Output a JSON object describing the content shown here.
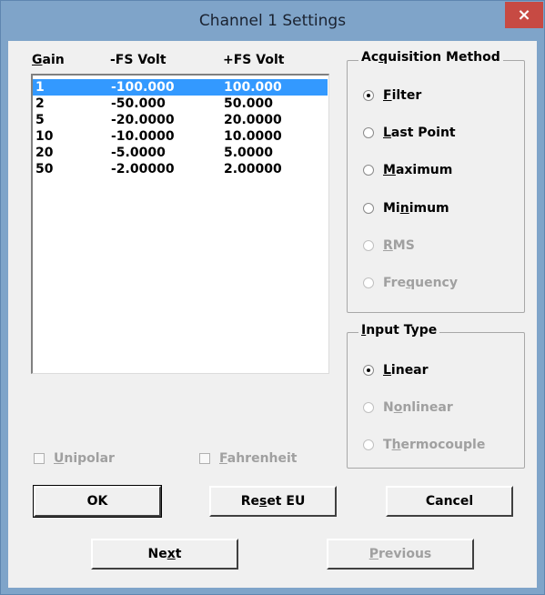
{
  "window": {
    "title": "Channel 1 Settings",
    "close_glyph": "×"
  },
  "gain_table": {
    "headers": {
      "gain": "Gain",
      "neg_fs": "-FS Volt",
      "pos_fs": "+FS Volt"
    },
    "rows": [
      {
        "gain": "1",
        "neg": "-100.000",
        "pos": "100.000",
        "selected": true
      },
      {
        "gain": "2",
        "neg": "-50.000",
        "pos": "50.000"
      },
      {
        "gain": "5",
        "neg": "-20.0000",
        "pos": "20.0000"
      },
      {
        "gain": "10",
        "neg": "-10.0000",
        "pos": "10.0000"
      },
      {
        "gain": "20",
        "neg": "-5.0000",
        "pos": "5.0000"
      },
      {
        "gain": "50",
        "neg": "-2.00000",
        "pos": "2.00000"
      }
    ]
  },
  "acquisition": {
    "title": "Acquisition Method",
    "options": [
      {
        "label": "Filter",
        "checked": true,
        "enabled": true
      },
      {
        "label": "Last Point",
        "checked": false,
        "enabled": true
      },
      {
        "label": "Maximum",
        "checked": false,
        "enabled": true
      },
      {
        "label": "Minimum",
        "checked": false,
        "enabled": true
      },
      {
        "label": "RMS",
        "checked": false,
        "enabled": false
      },
      {
        "label": "Frequency",
        "checked": false,
        "enabled": false
      }
    ]
  },
  "input_type": {
    "title": "Input Type",
    "options": [
      {
        "label": "Linear",
        "checked": true,
        "enabled": true
      },
      {
        "label": "Nonlinear",
        "checked": false,
        "enabled": false
      },
      {
        "label": "Thermocouple",
        "checked": false,
        "enabled": false
      }
    ]
  },
  "checkboxes": {
    "unipolar": "Unipolar",
    "fahrenheit": "Fahrenheit"
  },
  "buttons": {
    "ok": "OK",
    "reset_eu": "Reset EU",
    "cancel": "Cancel",
    "next": "Next",
    "previous": "Previous"
  }
}
